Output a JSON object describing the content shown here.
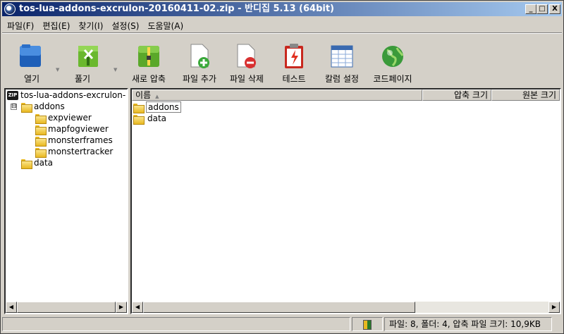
{
  "window": {
    "title": "tos-lua-addons-excrulon-20160411-02.zip - 반디집 5.13 (64bit)",
    "controls": {
      "minimize": "_",
      "maximize": "□",
      "close": "X"
    }
  },
  "menu": [
    {
      "label": "파일(F)"
    },
    {
      "label": "편집(E)"
    },
    {
      "label": "찾기(I)"
    },
    {
      "label": "설정(S)"
    },
    {
      "label": "도움말(A)"
    }
  ],
  "toolbar": {
    "open": "열기",
    "extract": "풀기",
    "new_archive": "새로 압축",
    "add_file": "파일 추가",
    "delete_file": "파일 삭제",
    "test": "테스트",
    "column_settings": "칼럼 설정",
    "codepage": "코드페이지"
  },
  "tree": {
    "root": "tos-lua-addons-excrulon-",
    "root_icon_text": "ZIP",
    "expander": "⊟",
    "addons": "addons",
    "children": [
      "expviewer",
      "mapfogviewer",
      "monsterframes",
      "monstertracker"
    ],
    "data": "data"
  },
  "list": {
    "columns": {
      "name": "이름",
      "packed_size": "압축 크기",
      "original_size": "원본 크기"
    },
    "rows": [
      {
        "name": "addons"
      },
      {
        "name": "data"
      }
    ]
  },
  "status": {
    "summary": "파일: 8, 폴더: 4, 압축 파일 크기: 10,9KB"
  },
  "colors": {
    "title_start": "#0a246a",
    "title_end": "#a6caf0",
    "chrome": "#d4d0c8"
  }
}
